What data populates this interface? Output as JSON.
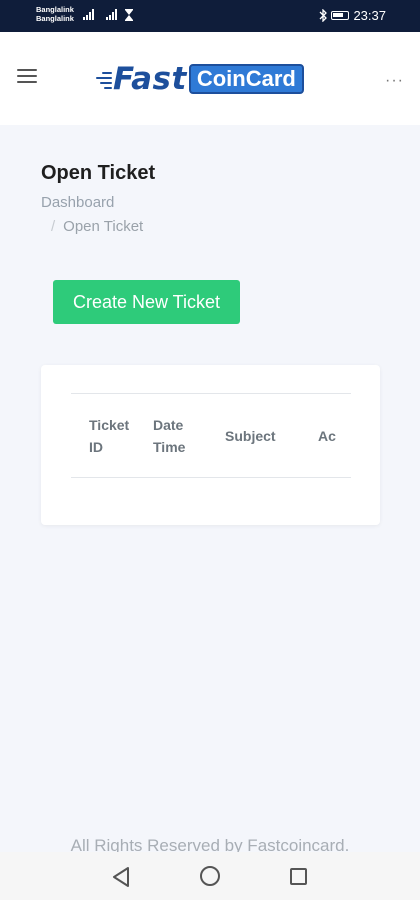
{
  "status_bar": {
    "carrier_1": "Banglalink",
    "carrier_2": "Banglalink",
    "time": "23:37",
    "icons": [
      "signal-icon",
      "signal-icon",
      "hourglass-icon",
      "bluetooth-icon",
      "battery-icon"
    ]
  },
  "header": {
    "menu_icon": "hamburger-menu-icon",
    "logo": {
      "fast": "Fast",
      "coincard": "CoinCard"
    },
    "more_icon": "more-dots-icon",
    "more_glyph": "···"
  },
  "page": {
    "title": "Open Ticket",
    "breadcrumb": {
      "home": "Dashboard",
      "separator": "/",
      "current": "Open Ticket"
    }
  },
  "actions": {
    "create_label": "Create New Ticket"
  },
  "table": {
    "columns": [
      {
        "line1": "Ticket",
        "line2": "ID"
      },
      {
        "line1": "Date",
        "line2": "Time"
      },
      {
        "line1": "Subject",
        "line2": ""
      },
      {
        "line1": "Ac",
        "line2": ""
      }
    ],
    "rows": []
  },
  "footer": {
    "text": "All Rights Reserved by Fastcoincard."
  },
  "nav_bar": {
    "icons": [
      "back-icon",
      "home-icon",
      "recent-apps-icon"
    ]
  },
  "colors": {
    "status_bar_bg": "#0f1d3a",
    "brand_dark": "#1d4f9c",
    "brand_light": "#2f7ad6",
    "primary_button": "#2ecb7a",
    "page_bg": "#f4f6fb"
  }
}
